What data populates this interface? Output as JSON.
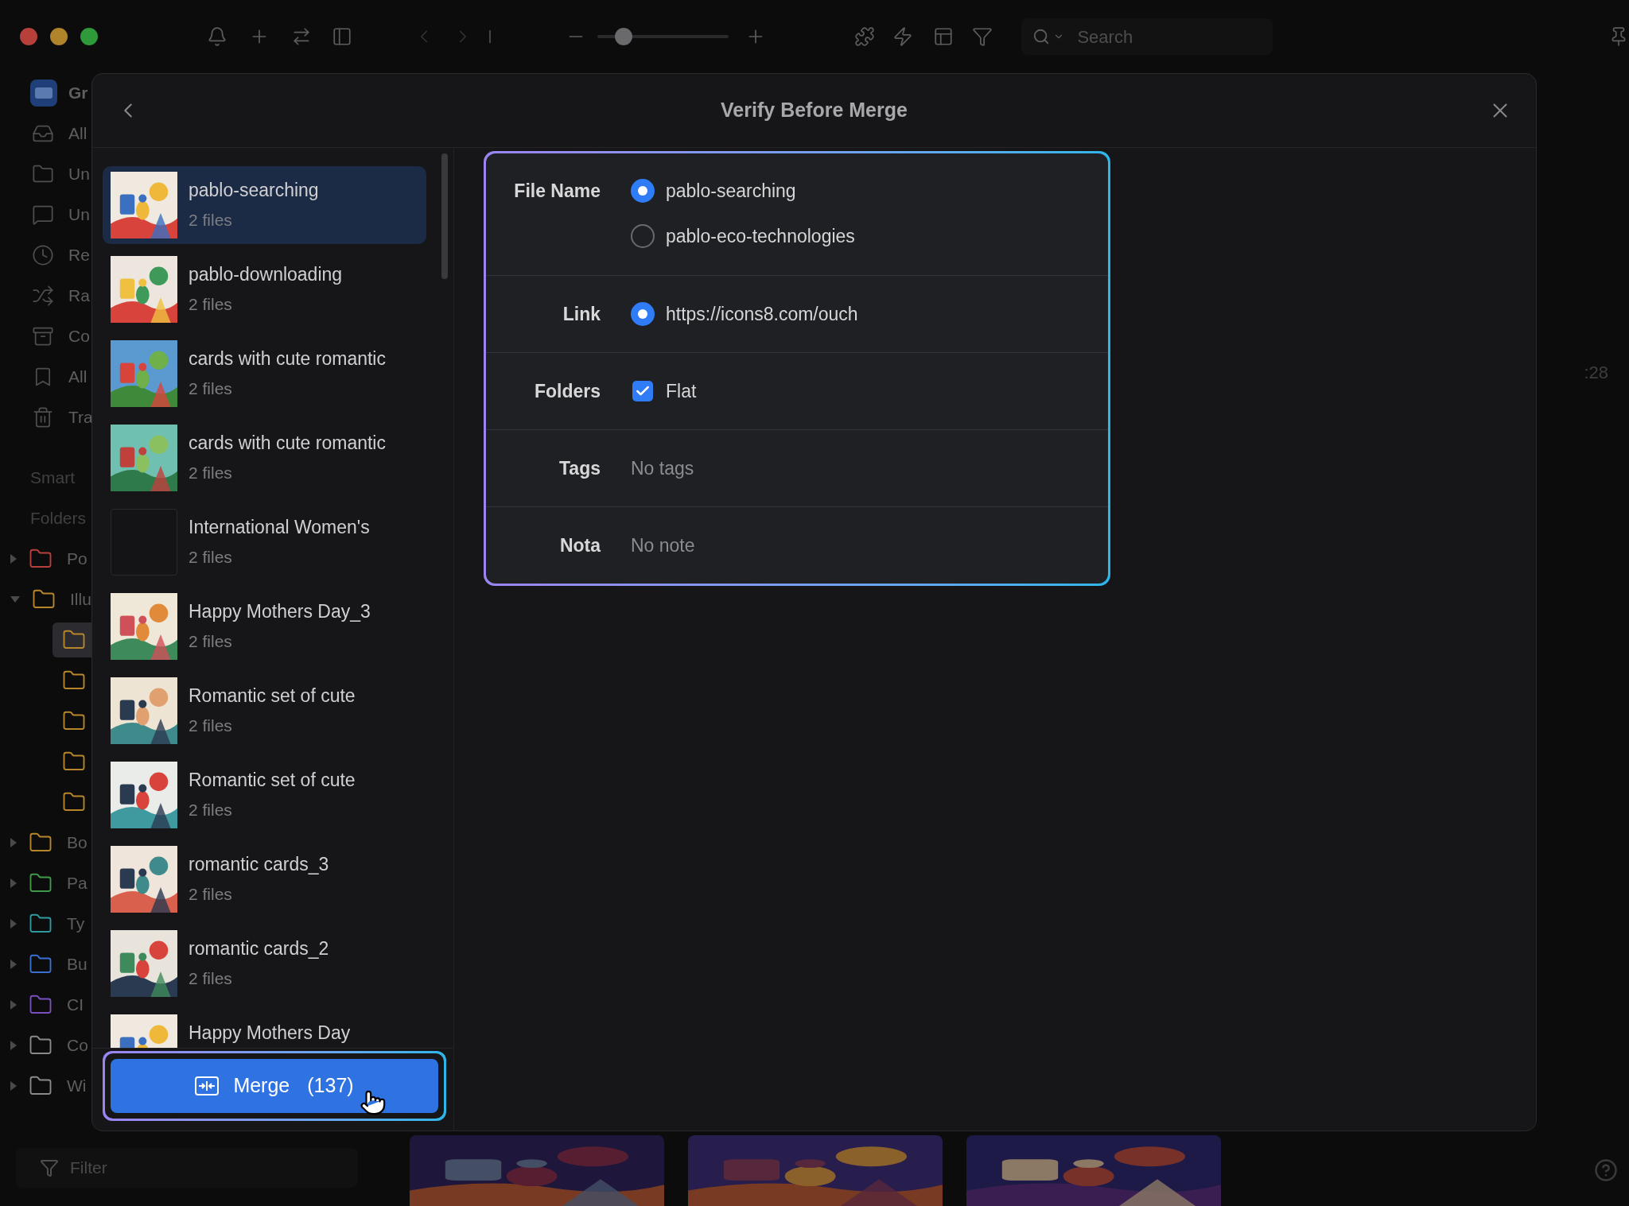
{
  "app": {
    "toolbar": {
      "zoom_slider": {
        "level": 0.15
      },
      "search": {
        "placeholder": "Search"
      }
    },
    "sidebar": {
      "header": "Gr",
      "items": [
        {
          "kind": "inbox",
          "label": "All"
        },
        {
          "kind": "folder",
          "label": "Un"
        },
        {
          "kind": "message",
          "label": "Un"
        },
        {
          "kind": "clock",
          "label": "Re"
        },
        {
          "kind": "shuffle",
          "label": "Ra"
        },
        {
          "kind": "archive",
          "label": "Co"
        },
        {
          "kind": "bookmark",
          "label": "All"
        },
        {
          "kind": "trash",
          "label": "Tra"
        }
      ],
      "sections": [
        "Smart",
        "Folders"
      ],
      "folders": [
        {
          "label": "Po",
          "color": "#b8403c",
          "expanded": false
        },
        {
          "label": "Illu",
          "color": "#b7862a",
          "expanded": true,
          "children": [
            {
              "color": "#b7862a",
              "selected": true
            },
            {
              "color": "#b7862a",
              "selected": false
            },
            {
              "color": "#b7862a",
              "selected": false
            },
            {
              "color": "#b7862a",
              "selected": false
            },
            {
              "color": "#b7862a",
              "selected": false
            }
          ]
        },
        {
          "label": "Bo",
          "color": "#b7862a",
          "expanded": false
        },
        {
          "label": "Pa",
          "color": "#3f9a4a",
          "expanded": false
        },
        {
          "label": "Ty",
          "color": "#2f9aa0",
          "expanded": false
        },
        {
          "label": "Bu",
          "color": "#3b6fd0",
          "expanded": false
        },
        {
          "label": "CI",
          "color": "#7a4fc0",
          "expanded": false
        },
        {
          "label": "Co",
          "color": "#8a8a8a",
          "expanded": false
        },
        {
          "label": "Wi",
          "color": "#8a8a8a",
          "expanded": false
        }
      ],
      "filter": {
        "placeholder": "Filter"
      }
    },
    "content": {
      "time_fragment": ":28"
    }
  },
  "dialog": {
    "title": "Verify Before Merge",
    "groups": [
      {
        "name": "pablo-searching",
        "count": "2 files",
        "kind": "picture",
        "selected": true
      },
      {
        "name": "pablo-downloading",
        "count": "2 files",
        "kind": "picture",
        "selected": false
      },
      {
        "name": "cards with cute romantic",
        "count": "2 files",
        "kind": "picture",
        "selected": false
      },
      {
        "name": "cards with cute romantic",
        "count": "2 files",
        "kind": "picture",
        "selected": false
      },
      {
        "name": "International Women's",
        "count": "2 files",
        "kind": "blank",
        "selected": false
      },
      {
        "name": "Happy Mothers Day_3",
        "count": "2 files",
        "kind": "picture",
        "selected": false
      },
      {
        "name": "Romantic set of cute",
        "count": "2 files",
        "kind": "picture",
        "selected": false
      },
      {
        "name": "Romantic set of cute",
        "count": "2 files",
        "kind": "picture",
        "selected": false
      },
      {
        "name": "romantic cards_3",
        "count": "2 files",
        "kind": "picture",
        "selected": false
      },
      {
        "name": "romantic cards_2",
        "count": "2 files",
        "kind": "picture",
        "selected": false
      },
      {
        "name": "Happy Mothers Day",
        "kind": "picture",
        "selected": false
      }
    ],
    "merge_button": {
      "label": "Merge",
      "count": "(137)"
    },
    "fields": [
      {
        "kind": "radio",
        "label": "File Name",
        "options": [
          {
            "text": "pablo-searching",
            "selected": true
          },
          {
            "text": "pablo-eco-technologies",
            "selected": false
          }
        ]
      },
      {
        "kind": "radio",
        "label": "Link",
        "options": [
          {
            "text": "https://icons8.com/ouch",
            "selected": true
          }
        ]
      },
      {
        "kind": "checkbox",
        "label": "Folders",
        "options": [
          {
            "text": "Flat",
            "checked": true
          }
        ]
      },
      {
        "kind": "text",
        "label": "Tags",
        "value": "No tags"
      },
      {
        "kind": "text",
        "label": "Nota",
        "value": "No note"
      }
    ]
  }
}
